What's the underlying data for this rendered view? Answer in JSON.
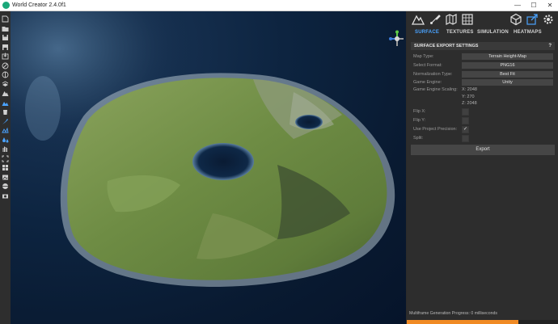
{
  "window": {
    "title": "World Creator 2.4.0f1",
    "controls": {
      "minimize": "—",
      "maximize": "☐",
      "close": "✕"
    }
  },
  "left_toolbar": {
    "items": [
      "new-file-icon",
      "open-folder-icon",
      "save-icon",
      "save-as-icon",
      "import-icon",
      "blend-icon",
      "filter-icon",
      "layers-icon",
      "mountains-icon",
      "terrain-icon",
      "bucket-icon",
      "brush-icon",
      "paint-icon",
      "droplets-icon",
      "hand-icon",
      "fullscreen-icon",
      "grid-icon",
      "image-icon",
      "sphere-icon",
      "camera-icon"
    ]
  },
  "panel": {
    "tabs": [
      "SURFACE",
      "TEXTURES",
      "SIMULATION",
      "HEATMAPS"
    ],
    "active_tab": "SURFACE",
    "section_title": "SURFACE EXPORT SETTINGS",
    "help": "?",
    "fields": {
      "map_type": {
        "label": "Map Type:",
        "value": "Terrain Height-Map"
      },
      "select_format": {
        "label": "Select Format:",
        "value": "PNG16"
      },
      "normalization_type": {
        "label": "Normalization Type:",
        "value": "Best Fit"
      },
      "game_engine": {
        "label": "Game Engine:",
        "value": "Unity"
      },
      "game_engine_scaling": {
        "label": "Game Engine Scaling:",
        "x": "X: 2048",
        "y": "Y: 270",
        "z": "Z: 2048"
      },
      "flip_x": {
        "label": "Flip X:",
        "checked": false
      },
      "flip_y": {
        "label": "Flip Y:",
        "checked": false
      },
      "use_project_precision": {
        "label": "Use Project Precision:",
        "checked": true,
        "mark": "✓"
      },
      "split": {
        "label": "Split:",
        "checked": false
      }
    },
    "export_button": "Export",
    "status": "Multiframe Generation Progress: 0 milliseconds",
    "progress": 0.74
  },
  "colors": {
    "accent": "#4aa3ff",
    "progress": "#f08a24",
    "ocean": "#0b2038",
    "terrain": "#6f8f45"
  }
}
